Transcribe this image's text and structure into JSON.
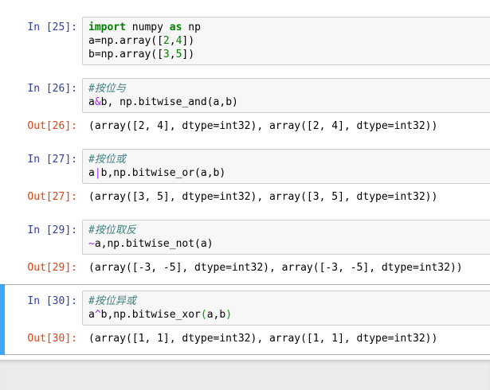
{
  "colors": {
    "in_prompt": "#303F9F",
    "out_prompt": "#D84315",
    "keyword": "#008000",
    "number": "#008000",
    "comment": "#408080",
    "operator": "#AA22FF",
    "matched_bracket": "#00A000",
    "selected_bar": "#42A5F5",
    "selected_border": "#ababab",
    "input_bg": "#f7f7f7",
    "input_border": "#cfcfcf",
    "footer_bg": "#ebebeb"
  },
  "notebook": {
    "cells": [
      {
        "in_prompt": "In [25]:",
        "selected": false,
        "source": [
          [
            {
              "t": "import",
              "c": "kw"
            },
            {
              "t": " numpy ",
              "c": "pl"
            },
            {
              "t": "as",
              "c": "kw"
            },
            {
              "t": " np",
              "c": "pl"
            }
          ],
          [
            {
              "t": "a=np.array([",
              "c": "pl"
            },
            {
              "t": "2",
              "c": "num"
            },
            {
              "t": ",",
              "c": "pl"
            },
            {
              "t": "4",
              "c": "num"
            },
            {
              "t": "])",
              "c": "pl"
            }
          ],
          [
            {
              "t": "b=np.array([",
              "c": "pl"
            },
            {
              "t": "3",
              "c": "num"
            },
            {
              "t": ",",
              "c": "pl"
            },
            {
              "t": "5",
              "c": "num"
            },
            {
              "t": "])",
              "c": "pl"
            }
          ]
        ],
        "out_prompt": null,
        "output": null
      },
      {
        "in_prompt": "In [26]:",
        "selected": false,
        "source": [
          [
            {
              "t": "#按位与",
              "c": "com"
            }
          ],
          [
            {
              "t": "a",
              "c": "pl"
            },
            {
              "t": "&",
              "c": "op"
            },
            {
              "t": "b, np.bitwise_and(a,b)",
              "c": "pl"
            }
          ]
        ],
        "out_prompt": "Out[26]:",
        "output": "(array([2, 4], dtype=int32), array([2, 4], dtype=int32))"
      },
      {
        "in_prompt": "In [27]:",
        "selected": false,
        "source": [
          [
            {
              "t": "#按位或",
              "c": "com"
            }
          ],
          [
            {
              "t": "a",
              "c": "pl"
            },
            {
              "t": "|",
              "c": "op"
            },
            {
              "t": "b,np.bitwise_or(a,b)",
              "c": "pl"
            }
          ]
        ],
        "out_prompt": "Out[27]:",
        "output": "(array([3, 5], dtype=int32), array([3, 5], dtype=int32))"
      },
      {
        "in_prompt": "In [29]:",
        "selected": false,
        "source": [
          [
            {
              "t": "#按位取反",
              "c": "com"
            }
          ],
          [
            {
              "t": "~",
              "c": "op"
            },
            {
              "t": "a,np.bitwise_not(a)",
              "c": "pl"
            }
          ]
        ],
        "out_prompt": "Out[29]:",
        "output": "(array([-3, -5], dtype=int32), array([-3, -5], dtype=int32))"
      },
      {
        "in_prompt": "In [30]:",
        "selected": true,
        "source": [
          [
            {
              "t": "#按位异或",
              "c": "com"
            }
          ],
          [
            {
              "t": "a",
              "c": "pl"
            },
            {
              "t": "^",
              "c": "op"
            },
            {
              "t": "b,np.bitwise_xor",
              "c": "pl"
            },
            {
              "t": "(",
              "c": "mb"
            },
            {
              "t": "a,b",
              "c": "pl"
            },
            {
              "t": ")",
              "c": "mb"
            }
          ]
        ],
        "out_prompt": "Out[30]:",
        "output": "(array([1, 1], dtype=int32), array([1, 1], dtype=int32))"
      }
    ]
  }
}
